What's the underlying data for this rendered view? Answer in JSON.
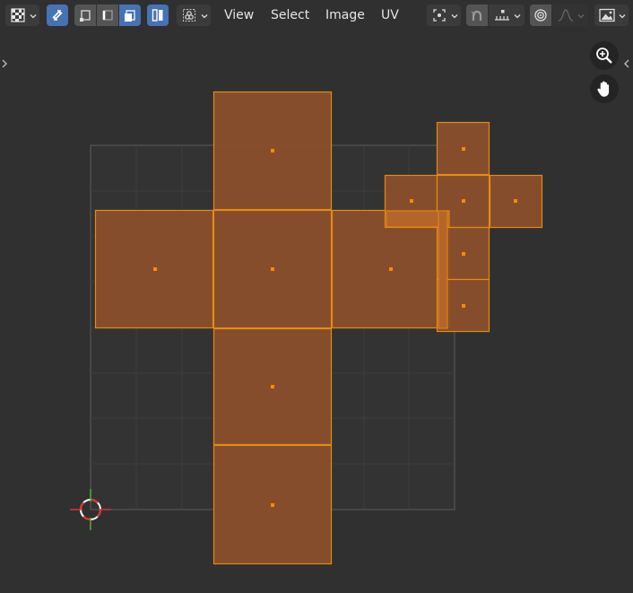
{
  "header": {
    "menus": [
      {
        "label": "View"
      },
      {
        "label": "Select"
      },
      {
        "label": "Image"
      },
      {
        "label": "UV"
      }
    ],
    "icons": {
      "editor_type": "uv-editor-icon",
      "sync_selection": "sync-selection-icon",
      "vertex_mode": "vertex-select-mode-icon",
      "edge_mode": "edge-select-mode-icon",
      "face_mode": "face-select-mode-icon",
      "island_mode": "island-select-mode-icon",
      "sticky_select": "sticky-selection-icon",
      "pivot": "pivot-point-icon",
      "snap": "snap-magnet-icon",
      "snap_target": "snap-increment-icon",
      "proportional": "proportional-editing-icon",
      "falloff": "falloff-curve-icon",
      "image_browse": "image-browse-icon"
    },
    "accent_color": "#4772b3"
  },
  "viewport": {
    "background": "#303030",
    "uv_face_fill": "#8a4f2a",
    "uv_edge_color": "#e58a14",
    "face_dot_color": "#ff8a00",
    "grid_line_color": "#3e3e3e",
    "nav_icons": [
      "zoom-in-icon",
      "pan-hand-icon"
    ]
  }
}
